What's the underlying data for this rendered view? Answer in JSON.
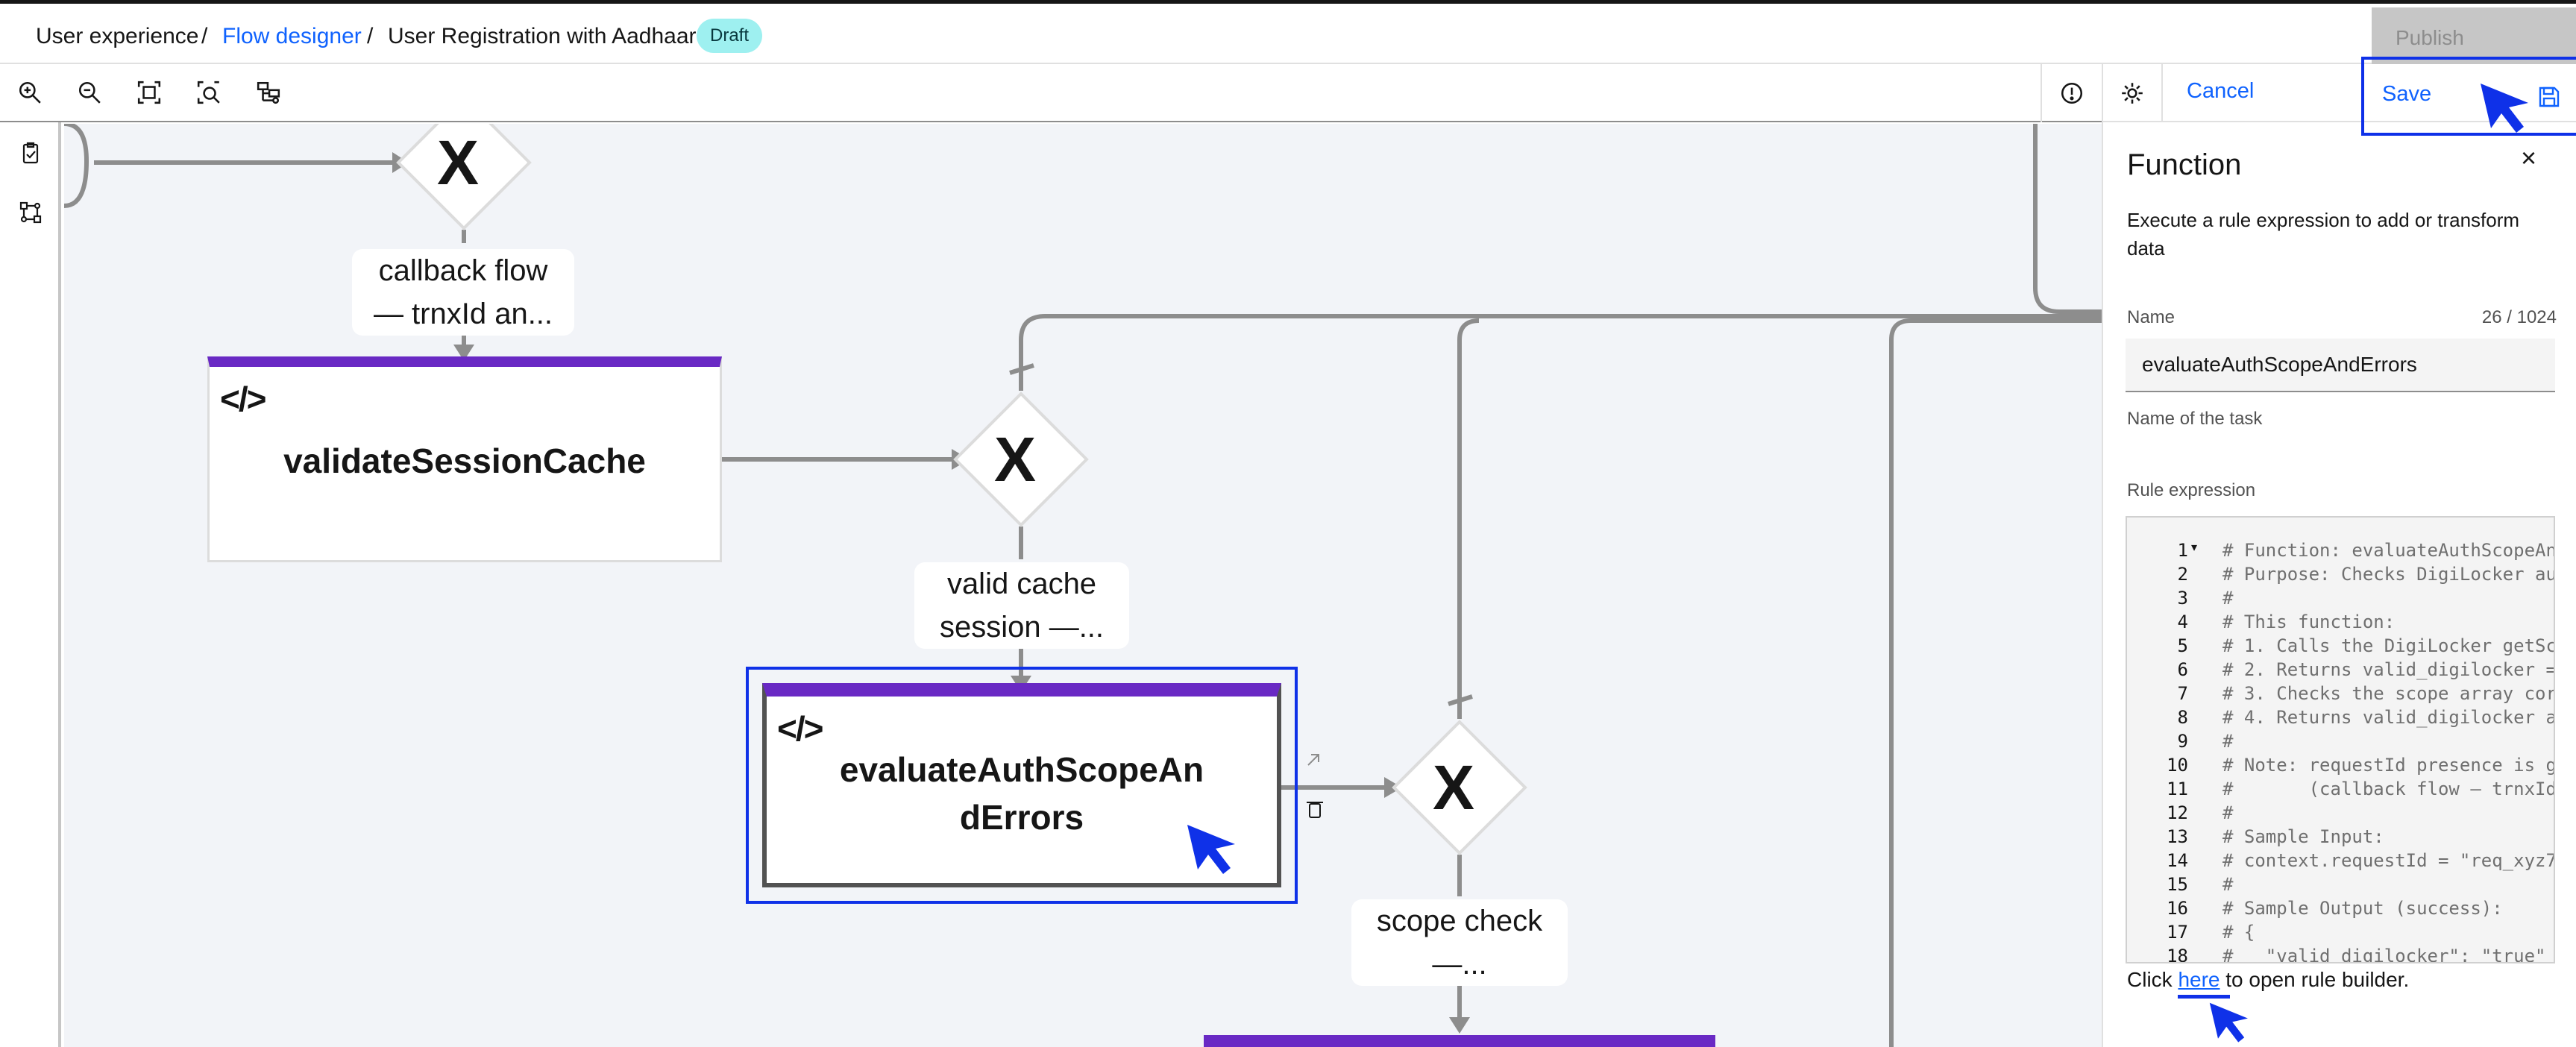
{
  "breadcrumb": {
    "items": [
      "User experience",
      "Flow designer",
      "User Registration with Aadhaar"
    ],
    "separator": "/",
    "status": "Draft"
  },
  "header": {
    "publish_label": "Publish"
  },
  "toolbar": {
    "icons": [
      "zoom-in-icon",
      "zoom-out-icon",
      "fit-to-screen-icon",
      "zoom-area-icon",
      "layout-icon"
    ],
    "info_icon": "info-icon"
  },
  "rail": {
    "icons": [
      "task-list-icon",
      "flow-map-icon"
    ]
  },
  "canvas": {
    "gateway_symbol": "X",
    "code_icon": "</>",
    "nodes": [
      {
        "name": "validateSessionCache"
      },
      {
        "name_line1": "evaluateAuthScopeAn",
        "name_line2": "dErrors"
      }
    ],
    "labels": [
      {
        "line1": "callback flow",
        "line2": "— trnxId an..."
      },
      {
        "line1": "valid cache",
        "line2": "session —..."
      },
      {
        "line1": "scope check",
        "line2": "—..."
      }
    ]
  },
  "panel": {
    "cancel_label": "Cancel",
    "save_label": "Save",
    "title": "Function",
    "description": "Execute a rule expression to add or transform data",
    "name_label": "Name",
    "name_counter": "26 / 1024",
    "name_value": "evaluateAuthScopeAndErrors",
    "name_helper": "Name of the task",
    "rule_label": "Rule expression",
    "code_lines": [
      "# Function: evaluateAuthScopeAn",
      "# Purpose: Checks DigiLocker au",
      "#",
      "# This function:",
      "# 1. Calls the DigiLocker getSc",
      "# 2. Returns valid_digilocker =",
      "# 3. Checks the scope array cor",
      "# 4. Returns valid_digilocker a",
      "#",
      "# Note: requestId presence is g",
      "#       (callback flow — trnxId",
      "#",
      "# Sample Input:",
      "# context.requestId = \"req_xyz7",
      "#",
      "# Sample Output (success):",
      "# {",
      "#   \"valid_digilocker\": \"true\""
    ],
    "line_numbers": [
      "1",
      "2",
      "3",
      "4",
      "5",
      "6",
      "7",
      "8",
      "9",
      "10",
      "11",
      "12",
      "13",
      "14",
      "15",
      "16",
      "17",
      "18"
    ],
    "footer_prefix": "Click",
    "footer_link": "here",
    "footer_suffix": "to open rule builder."
  },
  "colors": {
    "accent": "#0f62fe",
    "node_bar": "#6929c4",
    "highlight": "#0f31e8",
    "draft_tag": "#9ef0f0"
  }
}
